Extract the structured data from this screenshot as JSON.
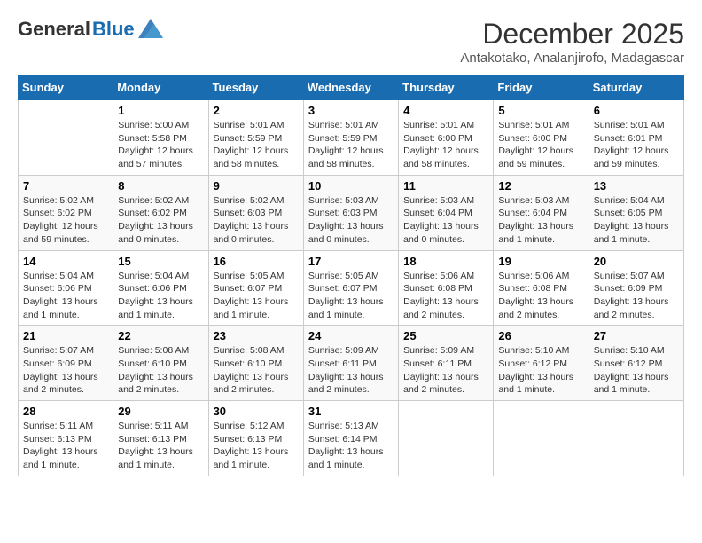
{
  "logo": {
    "general": "General",
    "blue": "Blue"
  },
  "title": "December 2025",
  "location": "Antakotako, Analanjirofo, Madagascar",
  "weekdays": [
    "Sunday",
    "Monday",
    "Tuesday",
    "Wednesday",
    "Thursday",
    "Friday",
    "Saturday"
  ],
  "weeks": [
    [
      {
        "day": "",
        "info": ""
      },
      {
        "day": "1",
        "info": "Sunrise: 5:00 AM\nSunset: 5:58 PM\nDaylight: 12 hours\nand 57 minutes."
      },
      {
        "day": "2",
        "info": "Sunrise: 5:01 AM\nSunset: 5:59 PM\nDaylight: 12 hours\nand 58 minutes."
      },
      {
        "day": "3",
        "info": "Sunrise: 5:01 AM\nSunset: 5:59 PM\nDaylight: 12 hours\nand 58 minutes."
      },
      {
        "day": "4",
        "info": "Sunrise: 5:01 AM\nSunset: 6:00 PM\nDaylight: 12 hours\nand 58 minutes."
      },
      {
        "day": "5",
        "info": "Sunrise: 5:01 AM\nSunset: 6:00 PM\nDaylight: 12 hours\nand 59 minutes."
      },
      {
        "day": "6",
        "info": "Sunrise: 5:01 AM\nSunset: 6:01 PM\nDaylight: 12 hours\nand 59 minutes."
      }
    ],
    [
      {
        "day": "7",
        "info": "Sunrise: 5:02 AM\nSunset: 6:02 PM\nDaylight: 12 hours\nand 59 minutes."
      },
      {
        "day": "8",
        "info": "Sunrise: 5:02 AM\nSunset: 6:02 PM\nDaylight: 13 hours\nand 0 minutes."
      },
      {
        "day": "9",
        "info": "Sunrise: 5:02 AM\nSunset: 6:03 PM\nDaylight: 13 hours\nand 0 minutes."
      },
      {
        "day": "10",
        "info": "Sunrise: 5:03 AM\nSunset: 6:03 PM\nDaylight: 13 hours\nand 0 minutes."
      },
      {
        "day": "11",
        "info": "Sunrise: 5:03 AM\nSunset: 6:04 PM\nDaylight: 13 hours\nand 0 minutes."
      },
      {
        "day": "12",
        "info": "Sunrise: 5:03 AM\nSunset: 6:04 PM\nDaylight: 13 hours\nand 1 minute."
      },
      {
        "day": "13",
        "info": "Sunrise: 5:04 AM\nSunset: 6:05 PM\nDaylight: 13 hours\nand 1 minute."
      }
    ],
    [
      {
        "day": "14",
        "info": "Sunrise: 5:04 AM\nSunset: 6:06 PM\nDaylight: 13 hours\nand 1 minute."
      },
      {
        "day": "15",
        "info": "Sunrise: 5:04 AM\nSunset: 6:06 PM\nDaylight: 13 hours\nand 1 minute."
      },
      {
        "day": "16",
        "info": "Sunrise: 5:05 AM\nSunset: 6:07 PM\nDaylight: 13 hours\nand 1 minute."
      },
      {
        "day": "17",
        "info": "Sunrise: 5:05 AM\nSunset: 6:07 PM\nDaylight: 13 hours\nand 1 minute."
      },
      {
        "day": "18",
        "info": "Sunrise: 5:06 AM\nSunset: 6:08 PM\nDaylight: 13 hours\nand 2 minutes."
      },
      {
        "day": "19",
        "info": "Sunrise: 5:06 AM\nSunset: 6:08 PM\nDaylight: 13 hours\nand 2 minutes."
      },
      {
        "day": "20",
        "info": "Sunrise: 5:07 AM\nSunset: 6:09 PM\nDaylight: 13 hours\nand 2 minutes."
      }
    ],
    [
      {
        "day": "21",
        "info": "Sunrise: 5:07 AM\nSunset: 6:09 PM\nDaylight: 13 hours\nand 2 minutes."
      },
      {
        "day": "22",
        "info": "Sunrise: 5:08 AM\nSunset: 6:10 PM\nDaylight: 13 hours\nand 2 minutes."
      },
      {
        "day": "23",
        "info": "Sunrise: 5:08 AM\nSunset: 6:10 PM\nDaylight: 13 hours\nand 2 minutes."
      },
      {
        "day": "24",
        "info": "Sunrise: 5:09 AM\nSunset: 6:11 PM\nDaylight: 13 hours\nand 2 minutes."
      },
      {
        "day": "25",
        "info": "Sunrise: 5:09 AM\nSunset: 6:11 PM\nDaylight: 13 hours\nand 2 minutes."
      },
      {
        "day": "26",
        "info": "Sunrise: 5:10 AM\nSunset: 6:12 PM\nDaylight: 13 hours\nand 1 minute."
      },
      {
        "day": "27",
        "info": "Sunrise: 5:10 AM\nSunset: 6:12 PM\nDaylight: 13 hours\nand 1 minute."
      }
    ],
    [
      {
        "day": "28",
        "info": "Sunrise: 5:11 AM\nSunset: 6:13 PM\nDaylight: 13 hours\nand 1 minute."
      },
      {
        "day": "29",
        "info": "Sunrise: 5:11 AM\nSunset: 6:13 PM\nDaylight: 13 hours\nand 1 minute."
      },
      {
        "day": "30",
        "info": "Sunrise: 5:12 AM\nSunset: 6:13 PM\nDaylight: 13 hours\nand 1 minute."
      },
      {
        "day": "31",
        "info": "Sunrise: 5:13 AM\nSunset: 6:14 PM\nDaylight: 13 hours\nand 1 minute."
      },
      {
        "day": "",
        "info": ""
      },
      {
        "day": "",
        "info": ""
      },
      {
        "day": "",
        "info": ""
      }
    ]
  ]
}
